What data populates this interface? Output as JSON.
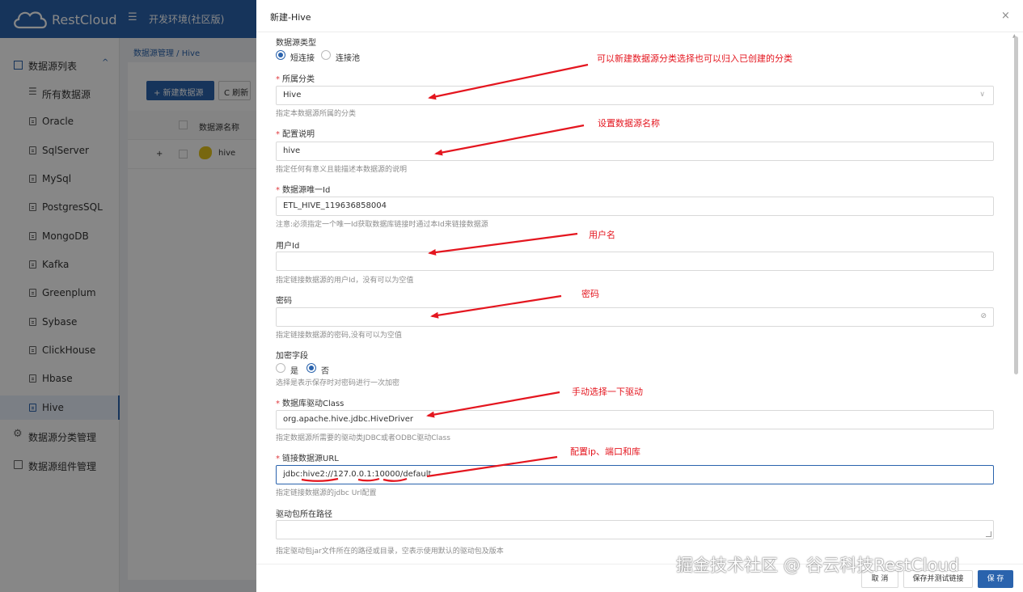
{
  "app": {
    "logo_text": "RestCloud",
    "environment": "开发环境(社区版)",
    "brand_color": "#2a63ad"
  },
  "sidebar": {
    "group_label": "数据源列表",
    "items": [
      {
        "label": "所有数据源"
      },
      {
        "label": "Oracle"
      },
      {
        "label": "SqlServer"
      },
      {
        "label": "MySql"
      },
      {
        "label": "PostgresSQL"
      },
      {
        "label": "MongoDB"
      },
      {
        "label": "Kafka"
      },
      {
        "label": "Greenplum"
      },
      {
        "label": "Sybase"
      },
      {
        "label": "ClickHouse"
      },
      {
        "label": "Hbase"
      },
      {
        "label": "Hive"
      }
    ],
    "active_item": "Hive",
    "bottom_items": [
      {
        "label": "数据源分类管理"
      },
      {
        "label": "数据源组件管理"
      }
    ]
  },
  "main": {
    "breadcrumb": "数据源管理 / Hive",
    "new_button": "+ 新建数据源",
    "refresh_button": "C 刷新",
    "table_header": "数据源名称",
    "row_plus": "+",
    "row_name": "hive"
  },
  "drawer": {
    "title": "新建-Hive",
    "close_icon": "×",
    "fields": {
      "type_label": "数据源类型",
      "type_options": [
        "短连接",
        "连接池"
      ],
      "type_selected": "短连接",
      "category_label": "所属分类",
      "category_value": "Hive",
      "category_hint": "指定本数据源所属的分类",
      "desc_label": "配置说明",
      "desc_value": "hive",
      "desc_hint": "指定任何有意义且能描述本数据源的说明",
      "id_label": "数据源唯一Id",
      "id_value": "ETL_HIVE_119636858004",
      "id_hint": "注意:必须指定一个唯一Id获取数据库链接时通过本Id来链接数据源",
      "user_label": "用户Id",
      "user_value": "",
      "user_hint": "指定链接数据源的用户Id，没有可以为空值",
      "pwd_label": "密码",
      "pwd_value": "",
      "pwd_hint": "指定链接数据源的密码,没有可以为空值",
      "encrypt_label": "加密字段",
      "encrypt_options": [
        "是",
        "否"
      ],
      "encrypt_selected": "否",
      "encrypt_hint": "选择是表示保存时对密码进行一次加密",
      "driver_label": "数据库驱动Class",
      "driver_value": "org.apache.hive.jdbc.HiveDriver",
      "driver_hint": "指定数据源所需要的驱动类JDBC或者ODBC驱动Class",
      "url_label": "链接数据源URL",
      "url_value": "jdbc:hive2://127.0.0.1:10000/default",
      "url_hint": "指定链接数据源的jdbc Url配置",
      "jar_label": "驱动包所在路径",
      "jar_value": "",
      "jar_hint": "指定驱动包jar文件所在的路径或目录，空表示使用默认的驱动包及版本"
    },
    "footer": {
      "cancel": "取 消",
      "save_test": "保存并测试链接",
      "save": "保 存"
    }
  },
  "annotations": {
    "category": "可以新建数据源分类选择也可以归入已创建的分类",
    "name": "设置数据源名称",
    "user": "用户名",
    "password": "密码",
    "driver": "手动选择一下驱动",
    "url": "配置ip、端口和库",
    "color": "#e4161f"
  },
  "watermark": "掘金技术社区 @ 谷云科技RestCloud"
}
